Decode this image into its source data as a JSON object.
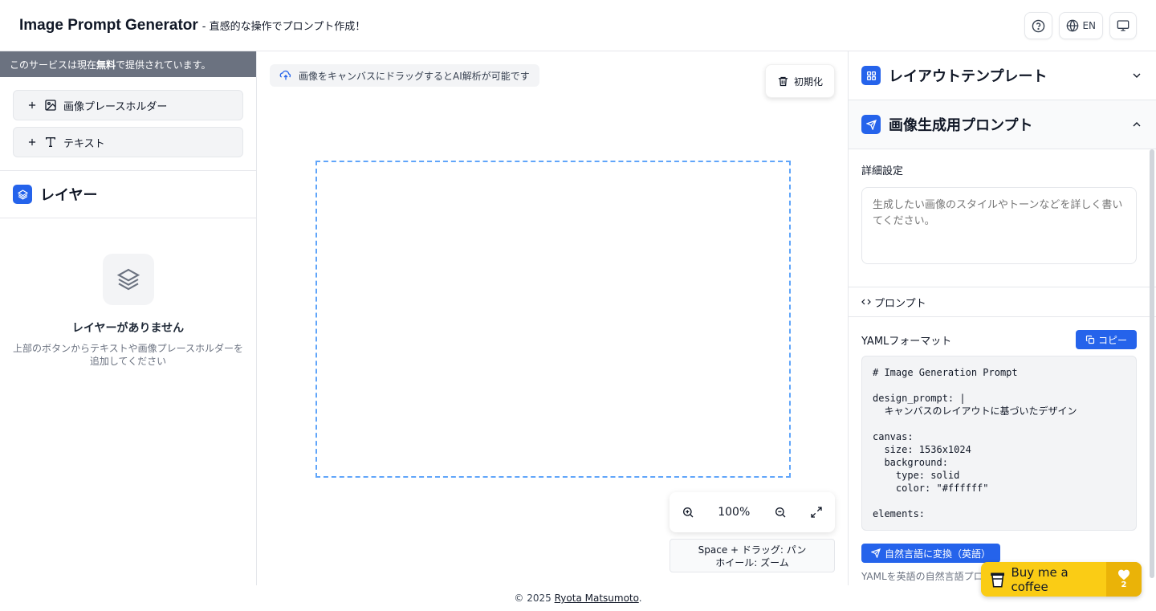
{
  "header": {
    "title": "Image Prompt Generator",
    "subtitle": "- 直感的な操作でプロンプト作成！",
    "lang_label": "EN"
  },
  "left": {
    "notice_pre": "このサービスは現在",
    "notice_bold": "無料",
    "notice_post": "で提供されています。",
    "add_image_label": "画像プレースホルダー",
    "add_text_label": "テキスト",
    "layers_title": "レイヤー",
    "empty_title": "レイヤーがありません",
    "empty_desc": "上部のボタンからテキストや画像プレースホルダーを追加してください"
  },
  "center": {
    "hint": "画像をキャンバスにドラッグするとAI解析が可能です",
    "reset_label": "初期化",
    "zoom_level": "100%",
    "help_line1": "Space + ドラッグ: パン",
    "help_line2": "ホイール: ズーム"
  },
  "right": {
    "layout_title": "レイアウトテンプレート",
    "prompt_title": "画像生成用プロンプト",
    "detail_label": "詳細設定",
    "detail_placeholder": "生成したい画像のスタイルやトーンなどを詳しく書いてください。",
    "prompt_tab": "プロンプト",
    "yaml_label": "YAMLフォーマット",
    "copy_label": "コピー",
    "yaml_code": "# Image Generation Prompt\n\ndesign_prompt: |\n  キャンバスのレイアウトに基づいたデザイン\n\ncanvas:\n  size: 1536x1024\n  background:\n    type: solid\n    color: \"#ffffff\"\n\nelements:",
    "convert_label": "自然言語に変換（英語）",
    "convert_desc": "YAMLを英語の自然言語プロ"
  },
  "footer": {
    "copyright": "© 2025",
    "author": "Ryota Matsumoto",
    "period": "."
  },
  "coffee": {
    "label": "Buy me a coffee",
    "count": "2"
  }
}
